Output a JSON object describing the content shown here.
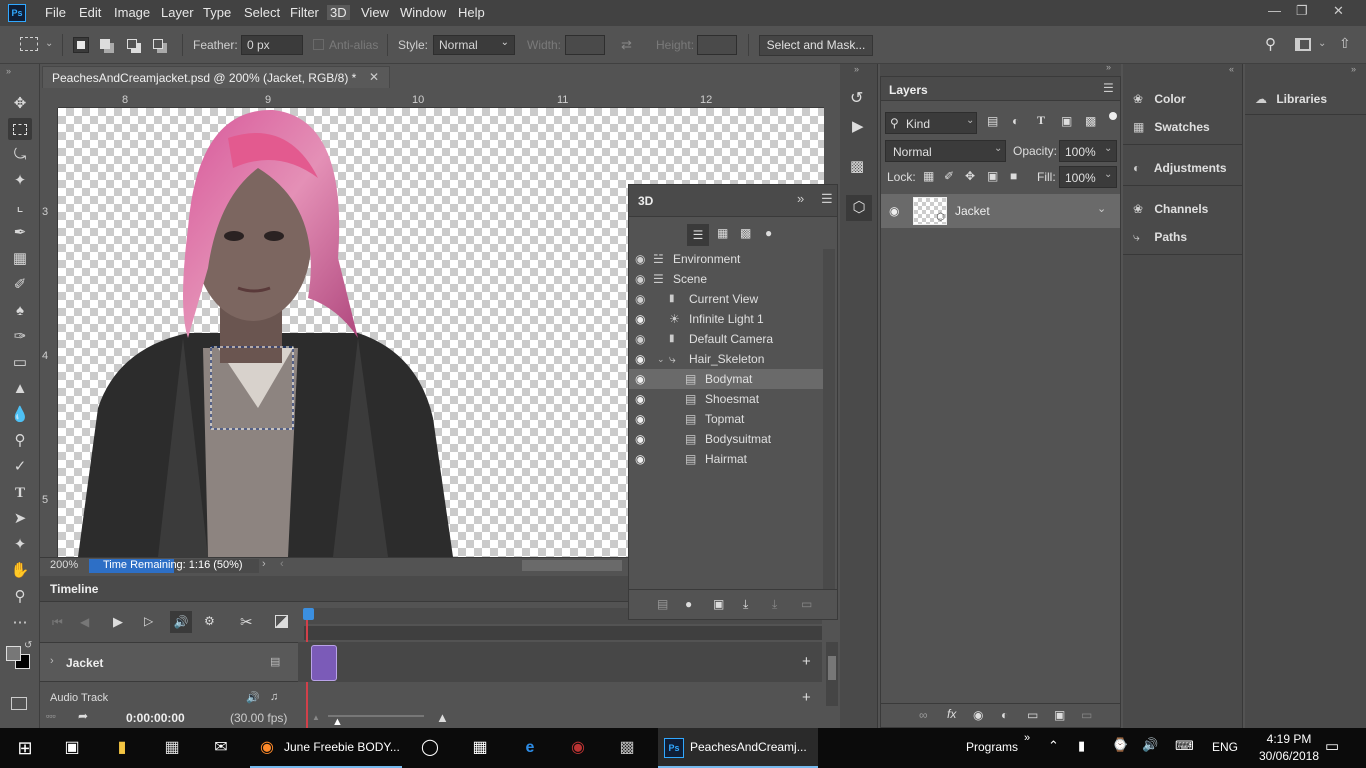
{
  "menubar": {
    "logo": "Ps",
    "items": [
      "File",
      "Edit",
      "Image",
      "Layer",
      "Type",
      "Select",
      "Filter",
      "3D",
      "View",
      "Window",
      "Help"
    ],
    "active_item": "3D"
  },
  "options": {
    "feather_label": "Feather:",
    "feather_value": "0 px",
    "antialias_label": "Anti-alias",
    "style_label": "Style:",
    "style_value": "Normal",
    "width_label": "Width:",
    "height_label": "Height:",
    "select_mask_label": "Select and Mask..."
  },
  "document": {
    "tab_title": "PeachesAndCreamjacket.psd @ 200% (Jacket, RGB/8) *",
    "ruler_top": [
      "8",
      "9",
      "10",
      "11",
      "12"
    ],
    "ruler_left": [
      "3",
      "4",
      "5"
    ]
  },
  "status": {
    "zoom": "200%",
    "progress_text": "Time Remaining: 1:16 (50%)",
    "progress": 0.5
  },
  "timeline": {
    "title": "Timeline",
    "track_name": "Jacket",
    "audio_track": "Audio Track",
    "timecode": "0:00:00:00",
    "fps": "(30.00 fps)"
  },
  "panel3d": {
    "title": "3D",
    "items": [
      {
        "label": "Environment",
        "icon": "environment-icon"
      },
      {
        "label": "Scene",
        "icon": "scene-icon"
      },
      {
        "label": "Current View",
        "icon": "camera-icon"
      },
      {
        "label": "Infinite Light 1",
        "icon": "light-icon"
      },
      {
        "label": "Default Camera",
        "icon": "camera-icon"
      },
      {
        "label": "Hair_Skeleton",
        "icon": "mesh-icon"
      },
      {
        "label": "Bodymat",
        "icon": "material-icon"
      },
      {
        "label": "Shoesmat",
        "icon": "material-icon"
      },
      {
        "label": "Topmat",
        "icon": "material-icon"
      },
      {
        "label": "Bodysuitmat",
        "icon": "material-icon"
      },
      {
        "label": "Hairmat",
        "icon": "material-icon"
      }
    ],
    "selected": "Bodymat"
  },
  "layers": {
    "title": "Layers",
    "filter_label": "Kind",
    "blend_mode": "Normal",
    "opacity_label": "Opacity:",
    "opacity_value": "100%",
    "lock_label": "Lock:",
    "fill_label": "Fill:",
    "fill_value": "100%",
    "layer_name": "Jacket"
  },
  "dock": {
    "color": "Color",
    "swatches": "Swatches",
    "adjustments": "Adjustments",
    "channels": "Channels",
    "paths": "Paths",
    "libraries": "Libraries"
  },
  "taskbar": {
    "firefox_title": "June Freebie BODY...",
    "ps_title": "PeachesAndCreamj...",
    "programs": "Programs",
    "lang": "ENG",
    "time": "4:19 PM",
    "date": "30/06/2018"
  },
  "colors": {
    "accent": "#31a8ff",
    "progress": "#2d6fc6",
    "playhead": "#d2404a",
    "clip": "#7b5bb8"
  }
}
